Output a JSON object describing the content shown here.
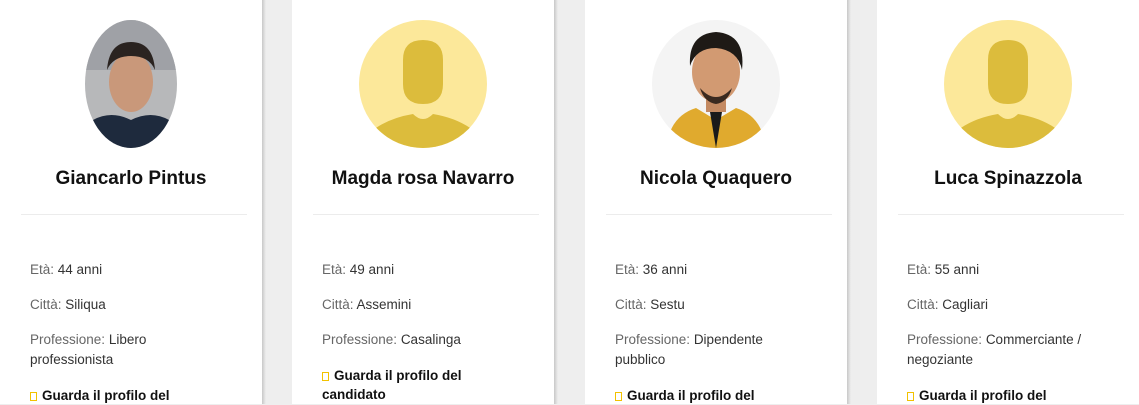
{
  "cards": [
    {
      "name": "Giancarlo Pintus",
      "age_label": "Età:",
      "age": "44 anni",
      "city_label": "Città:",
      "city": "Siliqua",
      "prof_label": "Professione:",
      "prof": "Libero professionista",
      "link": "Guarda il profilo del",
      "link_icon": "file-icon",
      "avatar": "photo"
    },
    {
      "name": "Magda rosa Navarro",
      "age_label": "Età:",
      "age": "49 anni",
      "city_label": "Città:",
      "city": "Assemini",
      "prof_label": "Professione:",
      "prof": "Casalinga",
      "link": "Guarda il profilo del candidato",
      "link_icon": "file-icon",
      "avatar": "placeholder"
    },
    {
      "name": "Nicola Quaquero",
      "age_label": "Età:",
      "age": "36 anni",
      "city_label": "Città:",
      "city": "Sestu",
      "prof_label": "Professione:",
      "prof": "Dipendente pubblico",
      "link": "Guarda il profilo del",
      "link_icon": "file-icon",
      "avatar": "photo"
    },
    {
      "name": "Luca Spinazzola",
      "age_label": "Età:",
      "age": "55 anni",
      "city_label": "Città:",
      "city": "Cagliari",
      "prof_label": "Professione:",
      "prof": "Commerciante / negoziante",
      "link": "Guarda il profilo del",
      "link_icon": "file-icon",
      "avatar": "placeholder"
    }
  ],
  "colors": {
    "placeholder_bg": "#fce89a",
    "placeholder_fg": "#dcbc3c",
    "link_icon": "#f2c200"
  }
}
